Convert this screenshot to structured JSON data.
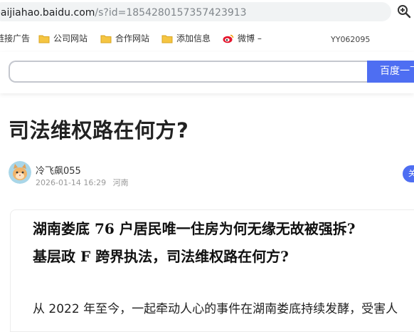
{
  "browser": {
    "url_host": "baijiahao.baidu.com",
    "url_path": "/s?id=1854280157357423913",
    "zoom_icon": "zoom-in-icon"
  },
  "bookmarks": {
    "items": [
      {
        "label": "链接广告",
        "icon": "none"
      },
      {
        "label": "公司网站",
        "icon": "folder-icon"
      },
      {
        "label": "合作网站",
        "icon": "folder-icon"
      },
      {
        "label": "添加信息",
        "icon": "folder-icon"
      },
      {
        "label": "微博 –",
        "icon": "weibo-icon"
      }
    ],
    "right_label": "YY062095"
  },
  "search": {
    "placeholder": "",
    "button_label": "百度一下",
    "accent": "#4e6ef2"
  },
  "article": {
    "title": "司法维权路在何方?",
    "author": {
      "name": "冷飞飙055",
      "date": "2026-01-14 16:29",
      "location": "河南",
      "avatar": "cat-avatar"
    },
    "follow_label": "关注",
    "heading_line1": "湖南娄底 76 户居民唯一住房为何无缘无故被强拆?",
    "heading_line2": "基层政 F 跨界执法，司法维权路在何方?",
    "paragraph": "从 2022 年至今，一起牵动人心的事件在湖南娄底持续发酵，受害人"
  }
}
